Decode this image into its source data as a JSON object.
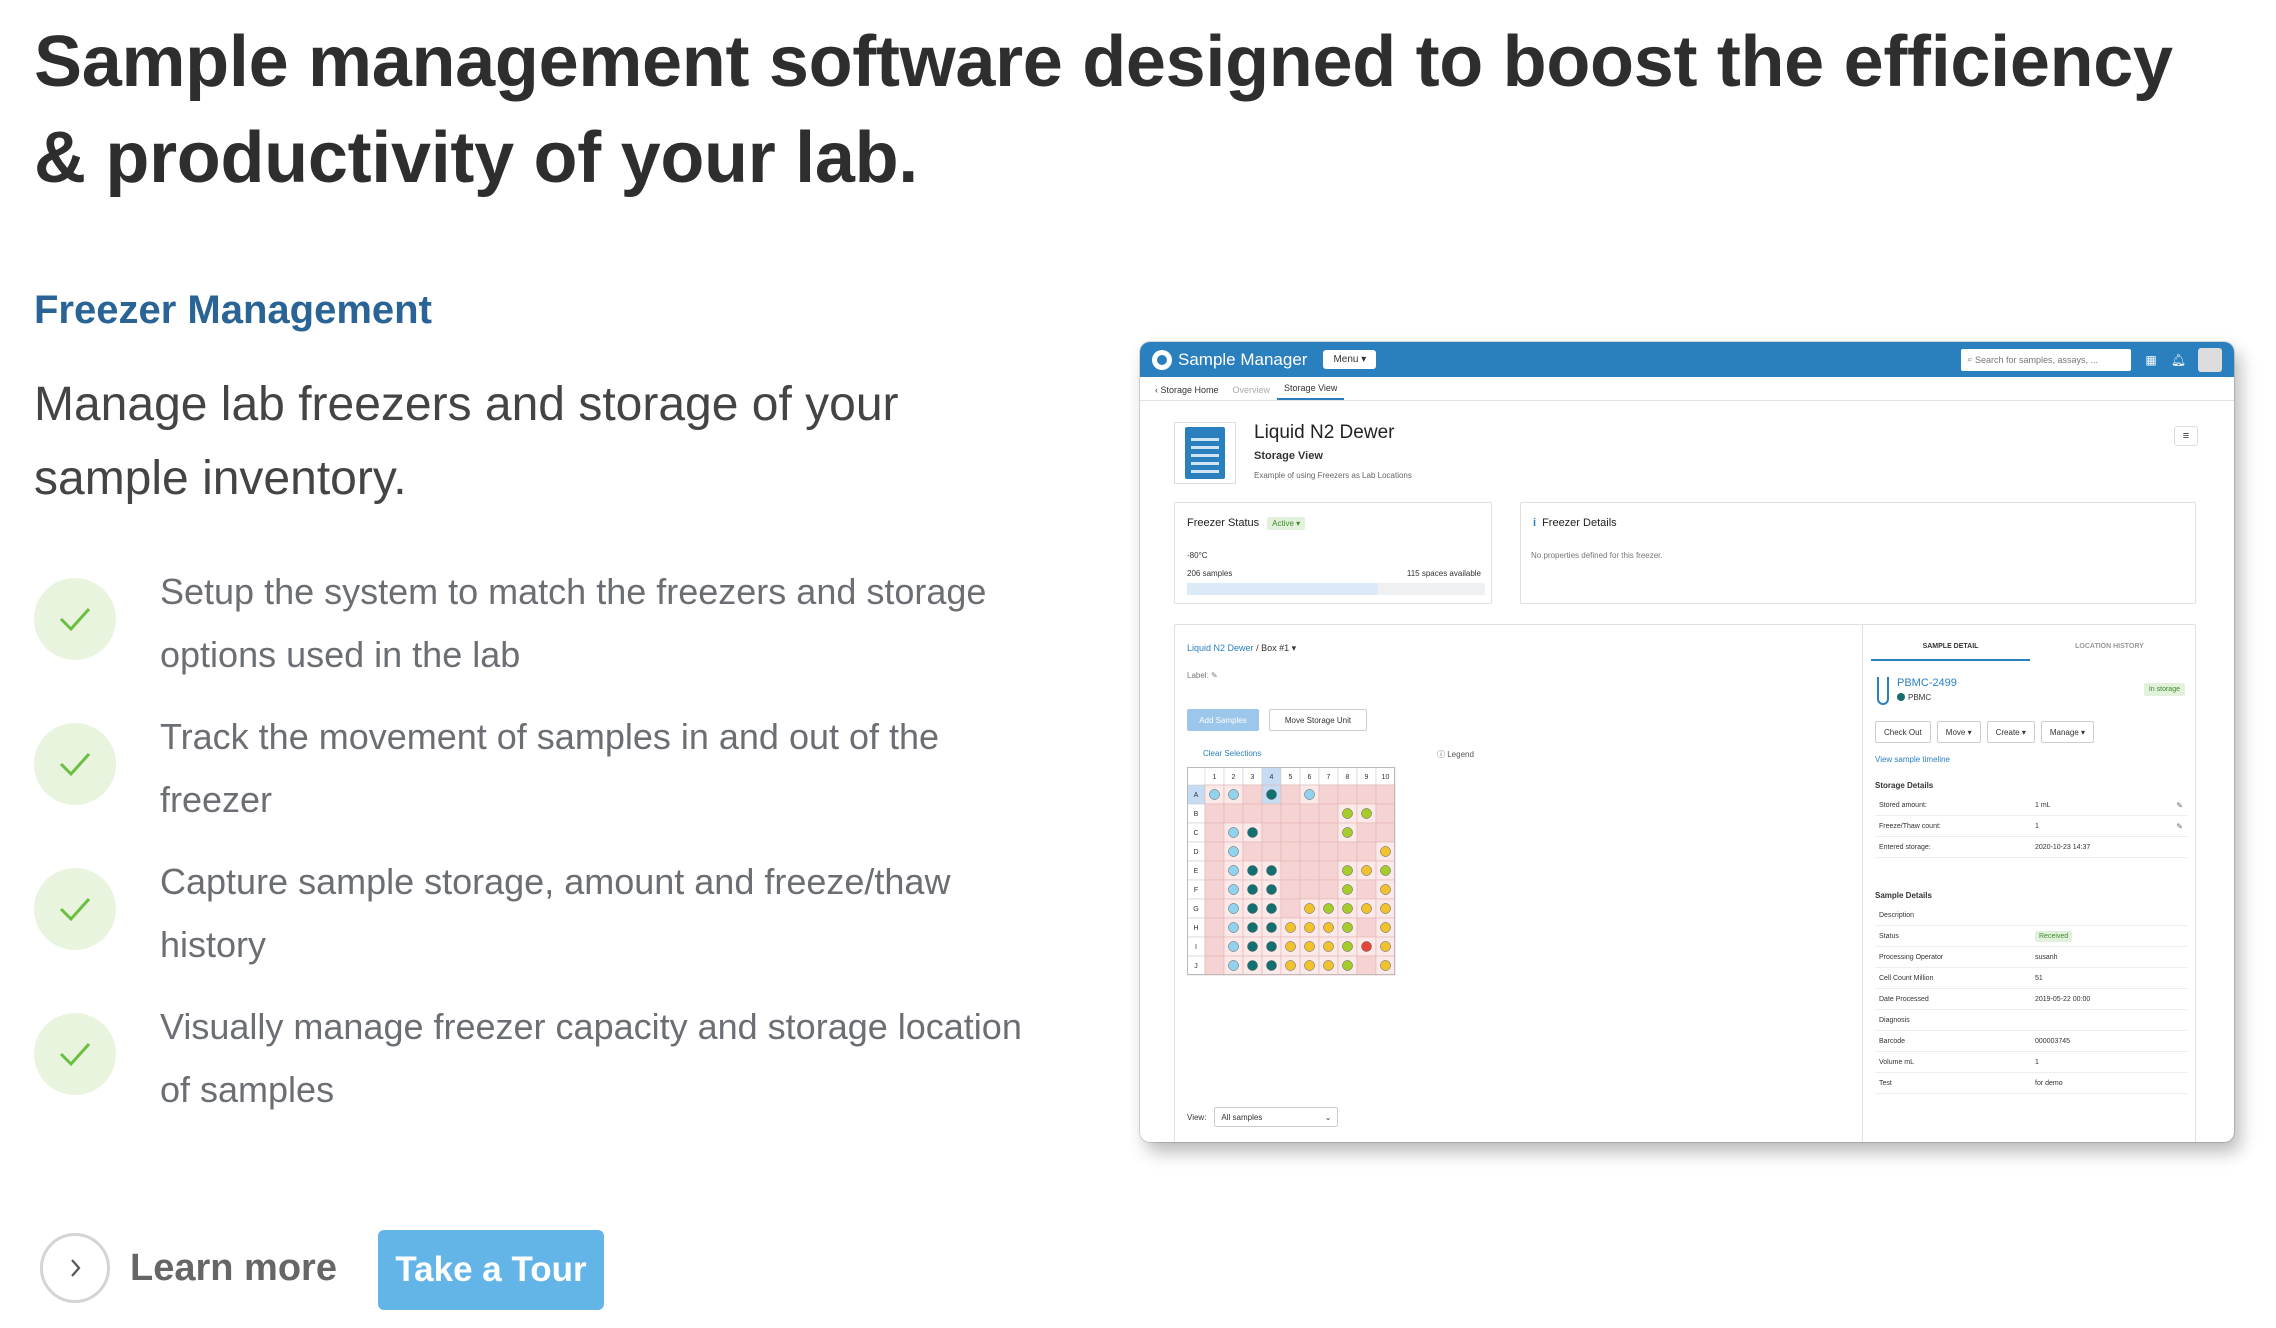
{
  "headline": "Sample management software designed to boost the efficiency & productivity of your lab.",
  "section_label": "Freezer Management",
  "lead": "Manage lab freezers and storage of your sample inventory.",
  "features": [
    {
      "text": "Setup the system to match the freezers and storage options used in the lab"
    },
    {
      "text": "Track the movement of samples in and out of the freezer"
    },
    {
      "text": "Capture sample storage, amount and freeze/thaw history"
    },
    {
      "text": "Visually manage freezer capacity and storage location of samples"
    }
  ],
  "cta": {
    "learn_more": "Learn more",
    "tour": "Take a Tour"
  },
  "colors": {
    "accent": "#2a6496",
    "button": "#63b5e8",
    "check_bg": "#e8f4dd",
    "check": "#6abf40",
    "app_bar": "#2a7fbf"
  },
  "app": {
    "title": "Sample Manager",
    "menu": "Menu ▾",
    "search_placeholder": "Search for samples, assays, ...",
    "subnav": {
      "back": "‹ Storage Home",
      "overview": "Overview",
      "storage_view": "Storage View"
    },
    "freezer": {
      "title": "Liquid N2 Dewer",
      "subtitle": "Storage View",
      "desc": "Example of using Freezers as Lab Locations"
    },
    "status": {
      "title": "Freezer Status",
      "badge": "Active ▾",
      "temp": "-80°C",
      "samples": "206 samples",
      "spaces": "115 spaces available",
      "fill_fraction": 0.64
    },
    "details": {
      "title": "Freezer Details",
      "empty": "No properties defined for this freezer."
    },
    "grid": {
      "crumb_link": "Liquid N2 Dewer",
      "crumb_sep": "/",
      "crumb_box": "Box #1 ▾",
      "label": "Label:",
      "add_button": "Add Samples",
      "move_button": "Move Storage Unit",
      "clear": "Clear Selections",
      "legend": "Legend",
      "cols": [
        "1",
        "2",
        "3",
        "4",
        "5",
        "6",
        "7",
        "8",
        "9",
        "10"
      ],
      "rows": [
        "A",
        "B",
        "C",
        "D",
        "E",
        "F",
        "G",
        "H",
        "I",
        "J"
      ],
      "cells": [
        "ll.d.l....",
        ".......gg.",
        ".ld....g..",
        ".l.......y",
        ".ldd...gyg",
        ".ldd...g.y",
        ".ldd.yggyy",
        ".lddyyyg.y",
        ".lddyyygry",
        ".lddyyyg.y"
      ],
      "view_label": "View:",
      "view_value": "All samples"
    },
    "detail": {
      "tab_detail": "SAMPLE DETAIL",
      "tab_history": "LOCATION HISTORY",
      "sample_id": "PBMC-2499",
      "sample_type": "PBMC",
      "status_badge": "In storage",
      "actions": [
        "Check Out",
        "Move ▾",
        "Create ▾",
        "Manage ▾"
      ],
      "timeline": "View sample timeline",
      "storage_heading": "Storage Details",
      "storage": [
        {
          "k": "Stored amount:",
          "v": "1 mL"
        },
        {
          "k": "Freeze/Thaw count:",
          "v": "1"
        },
        {
          "k": "Entered storage:",
          "v": "2020-10-23 14:37"
        }
      ],
      "sample_heading": "Sample Details",
      "sample": [
        {
          "k": "Description",
          "v": ""
        },
        {
          "k": "Status",
          "v": "Received"
        },
        {
          "k": "Processing Operator",
          "v": "susanh"
        },
        {
          "k": "Cell Count Million",
          "v": "51"
        },
        {
          "k": "Date Processed",
          "v": "2019-05-22 00:00"
        },
        {
          "k": "Diagnosis",
          "v": ""
        },
        {
          "k": "Barcode",
          "v": "000003745"
        },
        {
          "k": "Volume mL",
          "v": "1"
        },
        {
          "k": "Test",
          "v": "for demo"
        }
      ]
    }
  }
}
